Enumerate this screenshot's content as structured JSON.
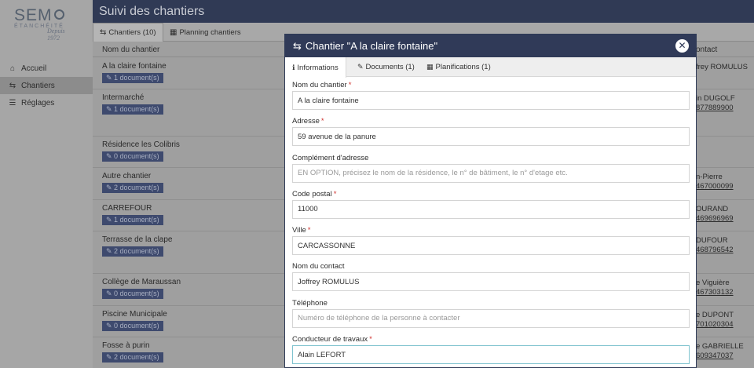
{
  "brand": {
    "main": "SEM",
    "sub": "ÉTANCHÉITÉ",
    "sign": "Depuis 1972"
  },
  "nav": [
    {
      "label": "Accueil",
      "icon": "home-icon",
      "active": false
    },
    {
      "label": "Chantiers",
      "icon": "signpost-icon",
      "active": true
    },
    {
      "label": "Réglages",
      "icon": "sliders-icon",
      "active": false
    }
  ],
  "page": {
    "title": "Suivi des chantiers"
  },
  "tabs": [
    {
      "label": "Chantiers (10)",
      "icon": "signpost-icon"
    },
    {
      "label": "Planning chantiers",
      "icon": "calendar-icon"
    }
  ],
  "table": {
    "col_name": "Nom du chantier",
    "col_contact": "ontact",
    "rows": [
      {
        "name": "A la claire fontaine",
        "docs": "1 document(s)",
        "contact": "frey ROMULUS",
        "phone": ""
      },
      {
        "name": "Intermarché",
        "docs": "1 document(s)",
        "contact": "in DUGOLF",
        "phone": "877889900"
      },
      {
        "name": "Résidence les Colibris",
        "docs": "0 document(s)",
        "contact": "",
        "phone": ""
      },
      {
        "name": "Autre chantier",
        "docs": "2 document(s)",
        "contact": "n-Pierre",
        "phone": "467000099"
      },
      {
        "name": "CARREFOUR",
        "docs": "1 document(s)",
        "contact": "OURAND",
        "phone": "469696969"
      },
      {
        "name": "Terrasse de la clape",
        "docs": "2 document(s)",
        "contact": "DUFOUR",
        "phone": "468796542"
      },
      {
        "name": "Collège de Maraussan",
        "docs": "0 document(s)",
        "contact": "e Viguière",
        "phone": "467303132"
      },
      {
        "name": "Piscine Municipale",
        "docs": "0 document(s)",
        "contact": "e DUPONT",
        "phone": "701020304"
      },
      {
        "name": "Fosse à purin",
        "docs": "2 document(s)",
        "contact": "e GABRIELLE",
        "phone": "609347037"
      }
    ]
  },
  "modal": {
    "title": "Chantier \"A la claire fontaine\"",
    "tabs": [
      {
        "label": "Informations",
        "icon": "info-icon"
      },
      {
        "label": "Documents (1)",
        "icon": "paperclip-icon"
      },
      {
        "label": "Planifications (1)",
        "icon": "calendar-icon"
      }
    ],
    "fields": [
      {
        "label": "Nom du chantier",
        "required": true,
        "value": "A la claire fontaine",
        "placeholder": ""
      },
      {
        "label": "Adresse",
        "required": true,
        "value": "59 avenue de la panure",
        "placeholder": ""
      },
      {
        "label": "Complément d'adresse",
        "required": false,
        "value": "",
        "placeholder": "EN OPTION, précisez le nom de la résidence, le n° de bâtiment, le n° d'etage etc."
      },
      {
        "label": "Code postal",
        "required": true,
        "value": "11000",
        "placeholder": ""
      },
      {
        "label": "Ville",
        "required": true,
        "value": "CARCASSONNE",
        "placeholder": ""
      },
      {
        "label": "Nom du contact",
        "required": false,
        "value": "Joffrey ROMULUS",
        "placeholder": ""
      },
      {
        "label": "Téléphone",
        "required": false,
        "value": "",
        "placeholder": "Numéro de téléphone de la personne à contacter"
      },
      {
        "label": "Conducteur de travaux",
        "required": true,
        "value": "Alain LEFORT",
        "placeholder": ""
      }
    ],
    "required_mark": "*"
  }
}
